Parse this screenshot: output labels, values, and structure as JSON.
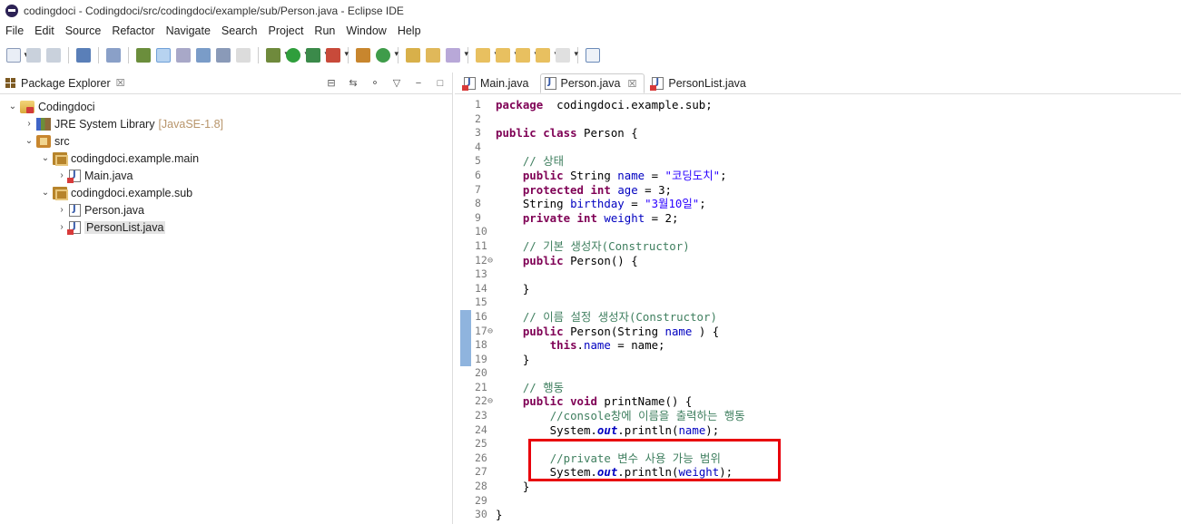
{
  "window": {
    "title": "codingdoci - Codingdoci/src/codingdoci/example/sub/Person.java - Eclipse IDE"
  },
  "menu": [
    "File",
    "Edit",
    "Source",
    "Refactor",
    "Navigate",
    "Search",
    "Project",
    "Run",
    "Window",
    "Help"
  ],
  "explorer": {
    "title": "Package Explorer",
    "close_glyph": "☒",
    "tree": [
      {
        "label": "Codingdoci",
        "indent": 0,
        "twisty": "open",
        "icon": "project-icon"
      },
      {
        "label": "JRE System Library",
        "tag": "[JavaSE-1.8]",
        "indent": 1,
        "twisty": "closed",
        "icon": "library-icon"
      },
      {
        "label": "src",
        "indent": 1,
        "twisty": "open",
        "icon": "source-folder-icon"
      },
      {
        "label": "codingdoci.example.main",
        "indent": 2,
        "twisty": "open",
        "icon": "package-icon"
      },
      {
        "label": "Main.java",
        "indent": 3,
        "twisty": "closed",
        "icon": "java-file-error-icon"
      },
      {
        "label": "codingdoci.example.sub",
        "indent": 2,
        "twisty": "open",
        "icon": "package-icon"
      },
      {
        "label": "Person.java",
        "indent": 3,
        "twisty": "closed",
        "icon": "java-file-icon"
      },
      {
        "label": "PersonList.java",
        "indent": 3,
        "twisty": "closed",
        "icon": "java-file-error-icon",
        "selected": true
      }
    ]
  },
  "editor": {
    "tabs": [
      {
        "label": "Main.java",
        "active": false,
        "error": true
      },
      {
        "label": "Person.java",
        "active": true,
        "error": false,
        "close_glyph": "☒"
      },
      {
        "label": "PersonList.java",
        "active": false,
        "error": true
      }
    ],
    "lines": [
      {
        "n": "1",
        "tokens": [
          [
            "kw",
            "package"
          ],
          [
            "",
            "  codingdoci.example.sub;"
          ]
        ]
      },
      {
        "n": "2",
        "tokens": []
      },
      {
        "n": "3",
        "tokens": [
          [
            "kw",
            "public"
          ],
          [
            "",
            " "
          ],
          [
            "kw",
            "class"
          ],
          [
            "",
            " Person {"
          ]
        ]
      },
      {
        "n": "4",
        "tokens": []
      },
      {
        "n": "5",
        "tokens": [
          [
            "",
            "    "
          ],
          [
            "cm",
            "// 상태"
          ]
        ]
      },
      {
        "n": "6",
        "tokens": [
          [
            "",
            "    "
          ],
          [
            "kw",
            "public"
          ],
          [
            "",
            " String "
          ],
          [
            "fld",
            "name"
          ],
          [
            "",
            " = "
          ],
          [
            "str",
            "\"코딩도치\""
          ],
          [
            ";"
          ]
        ]
      },
      {
        "n": "7",
        "tokens": [
          [
            "",
            "    "
          ],
          [
            "kw",
            "protected"
          ],
          [
            "",
            " "
          ],
          [
            "kw",
            "int"
          ],
          [
            "",
            " "
          ],
          [
            "fld",
            "age"
          ],
          [
            "",
            " = 3;"
          ]
        ]
      },
      {
        "n": "8",
        "tokens": [
          [
            "",
            "    String "
          ],
          [
            "fld",
            "birthday"
          ],
          [
            "",
            " = "
          ],
          [
            "str",
            "\"3월10일\""
          ],
          [
            "",
            ";"
          ]
        ]
      },
      {
        "n": "9",
        "tokens": [
          [
            "",
            "    "
          ],
          [
            "kw",
            "private"
          ],
          [
            "",
            " "
          ],
          [
            "kw",
            "int"
          ],
          [
            "",
            " "
          ],
          [
            "fld",
            "weight"
          ],
          [
            "",
            " = 2;"
          ]
        ]
      },
      {
        "n": "10",
        "tokens": []
      },
      {
        "n": "11",
        "tokens": [
          [
            "",
            "    "
          ],
          [
            "cm",
            "// 기본 생성자(Constructor)"
          ]
        ]
      },
      {
        "n": "12",
        "fold": true,
        "tokens": [
          [
            "",
            "    "
          ],
          [
            "kw",
            "public"
          ],
          [
            "",
            " Person() {"
          ]
        ]
      },
      {
        "n": "13",
        "tokens": []
      },
      {
        "n": "14",
        "tokens": [
          [
            "",
            "    }"
          ]
        ]
      },
      {
        "n": "15",
        "tokens": []
      },
      {
        "n": "16",
        "mark": true,
        "tokens": [
          [
            "",
            "    "
          ],
          [
            "cm",
            "// 이름 설정 생성자(Constructor)"
          ]
        ]
      },
      {
        "n": "17",
        "mark": true,
        "fold": true,
        "tokens": [
          [
            "",
            "    "
          ],
          [
            "kw",
            "public"
          ],
          [
            "",
            " Person(String "
          ],
          [
            "fld",
            "name"
          ],
          [
            "",
            " ) {"
          ]
        ]
      },
      {
        "n": "18",
        "mark": true,
        "tokens": [
          [
            "",
            "        "
          ],
          [
            "kw",
            "this"
          ],
          [
            "",
            "."
          ],
          [
            "fld",
            "name"
          ],
          [
            "",
            " = name;"
          ]
        ]
      },
      {
        "n": "19",
        "mark": true,
        "tokens": [
          [
            "",
            "    }"
          ]
        ]
      },
      {
        "n": "20",
        "tokens": []
      },
      {
        "n": "21",
        "tokens": [
          [
            "",
            "    "
          ],
          [
            "cm",
            "// 행동"
          ]
        ]
      },
      {
        "n": "22",
        "fold": true,
        "tokens": [
          [
            "",
            "    "
          ],
          [
            "kw",
            "public"
          ],
          [
            "",
            " "
          ],
          [
            "kw",
            "void"
          ],
          [
            "",
            " printName() {"
          ]
        ]
      },
      {
        "n": "23",
        "tokens": [
          [
            "",
            "        "
          ],
          [
            "cm",
            "//console창에 이름을 출력하는 행동"
          ]
        ]
      },
      {
        "n": "24",
        "tokens": [
          [
            "",
            "        System."
          ],
          [
            "sfld",
            "out"
          ],
          [
            "",
            ".println("
          ],
          [
            "fld",
            "name"
          ],
          [
            "",
            ");"
          ]
        ]
      },
      {
        "n": "25",
        "tokens": []
      },
      {
        "n": "26",
        "tokens": [
          [
            "",
            "        "
          ],
          [
            "cm",
            "//private 변수 사용 가능 범위"
          ]
        ]
      },
      {
        "n": "27",
        "tokens": [
          [
            "",
            "        System."
          ],
          [
            "sfld",
            "out"
          ],
          [
            "",
            ".println("
          ],
          [
            "fld",
            "weight"
          ],
          [
            "",
            ");"
          ]
        ]
      },
      {
        "n": "28",
        "tokens": [
          [
            "",
            "    }"
          ]
        ]
      },
      {
        "n": "29",
        "tokens": []
      },
      {
        "n": "30",
        "tokens": [
          [
            "",
            "}"
          ]
        ]
      }
    ]
  },
  "annotation": {
    "color": "#e8000b"
  }
}
